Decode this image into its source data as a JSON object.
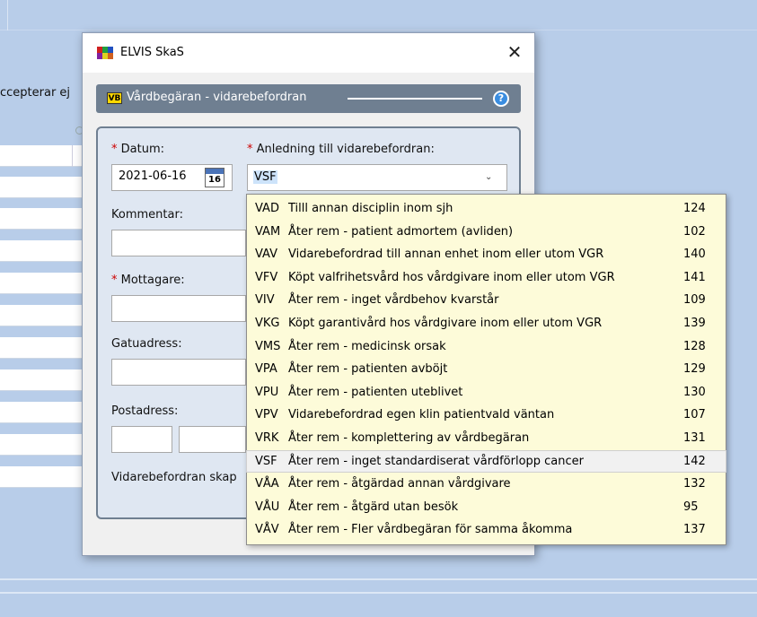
{
  "background": {
    "partial_text": "ccepterar ej"
  },
  "dialog": {
    "title": "ELVIS SkaS",
    "close_glyph": "✕",
    "header": {
      "badge": "VB",
      "title": "Vårdbegäran - vidarebefordran",
      "help_glyph": "?"
    },
    "form": {
      "datum_label": "Datum:",
      "datum_value": "2021-06-16",
      "calendar_day": "16",
      "anledning_label": "Anledning till vidarebefordran:",
      "anledning_value": "VSF",
      "kommentar_label": "Kommentar:",
      "mottagare_label": "Mottagare:",
      "gatuadress_label": "Gatuadress:",
      "postadress_label": "Postadress:",
      "vidarebefordran_label": "Vidarebefordran skap",
      "required_mark": "*"
    }
  },
  "dropdown": {
    "selected_code": "VSF",
    "options": [
      {
        "code": "VAD",
        "desc": "Tilll annan disciplin inom sjh",
        "num": "124"
      },
      {
        "code": "VAM",
        "desc": "Åter rem - patient admortem (avliden)",
        "num": "102"
      },
      {
        "code": "VAV",
        "desc": "Vidarebefordrad till annan enhet inom eller utom VGR",
        "num": "140"
      },
      {
        "code": "VFV",
        "desc": "Köpt valfrihetsvård hos vårdgivare inom eller utom VGR",
        "num": "141"
      },
      {
        "code": "VIV",
        "desc": "Åter rem - inget vårdbehov kvarstår",
        "num": "109"
      },
      {
        "code": "VKG",
        "desc": "Köpt garantivård hos vårdgivare inom eller utom VGR",
        "num": "139"
      },
      {
        "code": "VMS",
        "desc": "Åter rem - medicinsk orsak",
        "num": "128"
      },
      {
        "code": "VPA",
        "desc": "Åter rem - patienten avböjt",
        "num": "129"
      },
      {
        "code": "VPU",
        "desc": "Åter rem - patienten uteblivet",
        "num": "130"
      },
      {
        "code": "VPV",
        "desc": "Vidarebefordrad egen klin patientvald väntan",
        "num": "107"
      },
      {
        "code": "VRK",
        "desc": "Åter rem - komplettering av vårdbegäran",
        "num": "131"
      },
      {
        "code": "VSF",
        "desc": "Åter rem - inget standardiserat vårdförlopp cancer",
        "num": "142"
      },
      {
        "code": "VÅA",
        "desc": "Åter rem - åtgärdad annan vårdgivare",
        "num": "132"
      },
      {
        "code": "VÅU",
        "desc": "Åter rem - åtgärd utan besök",
        "num": "95"
      },
      {
        "code": "VÅV",
        "desc": "Åter rem - Fler vårdbegäran för samma åkomma",
        "num": "137"
      }
    ]
  }
}
